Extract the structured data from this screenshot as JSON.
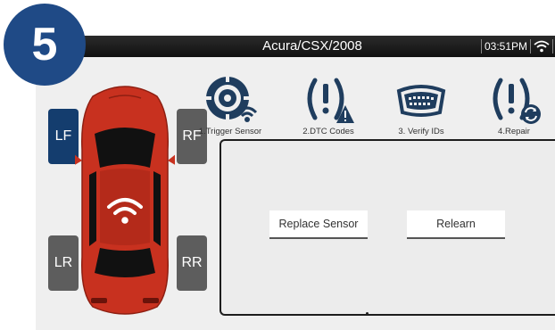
{
  "step": {
    "number": "5"
  },
  "header": {
    "title": "Acura/CSX/2008",
    "time": "03:51PM"
  },
  "tires": {
    "lf": "LF",
    "rf": "RF",
    "lr": "LR",
    "rr": "RR",
    "active": "LF"
  },
  "toolbar": {
    "items": [
      {
        "label": "1.Trigger Sensor",
        "icon": "tire-signal-icon"
      },
      {
        "label": "2.DTC Codes",
        "icon": "tpms-warning-icon"
      },
      {
        "label": "3. Verify IDs",
        "icon": "obd-connector-icon"
      },
      {
        "label": "4.Repair",
        "icon": "tpms-repair-icon"
      }
    ]
  },
  "panel": {
    "replace_label": "Replace Sensor",
    "relearn_label": "Relearn"
  },
  "colors": {
    "badge": "#1f4a86",
    "tire_active": "#143d6e",
    "tire_inactive": "#5d5d5d",
    "car": "#c8311f",
    "titlebar": "#1a1a1a"
  }
}
